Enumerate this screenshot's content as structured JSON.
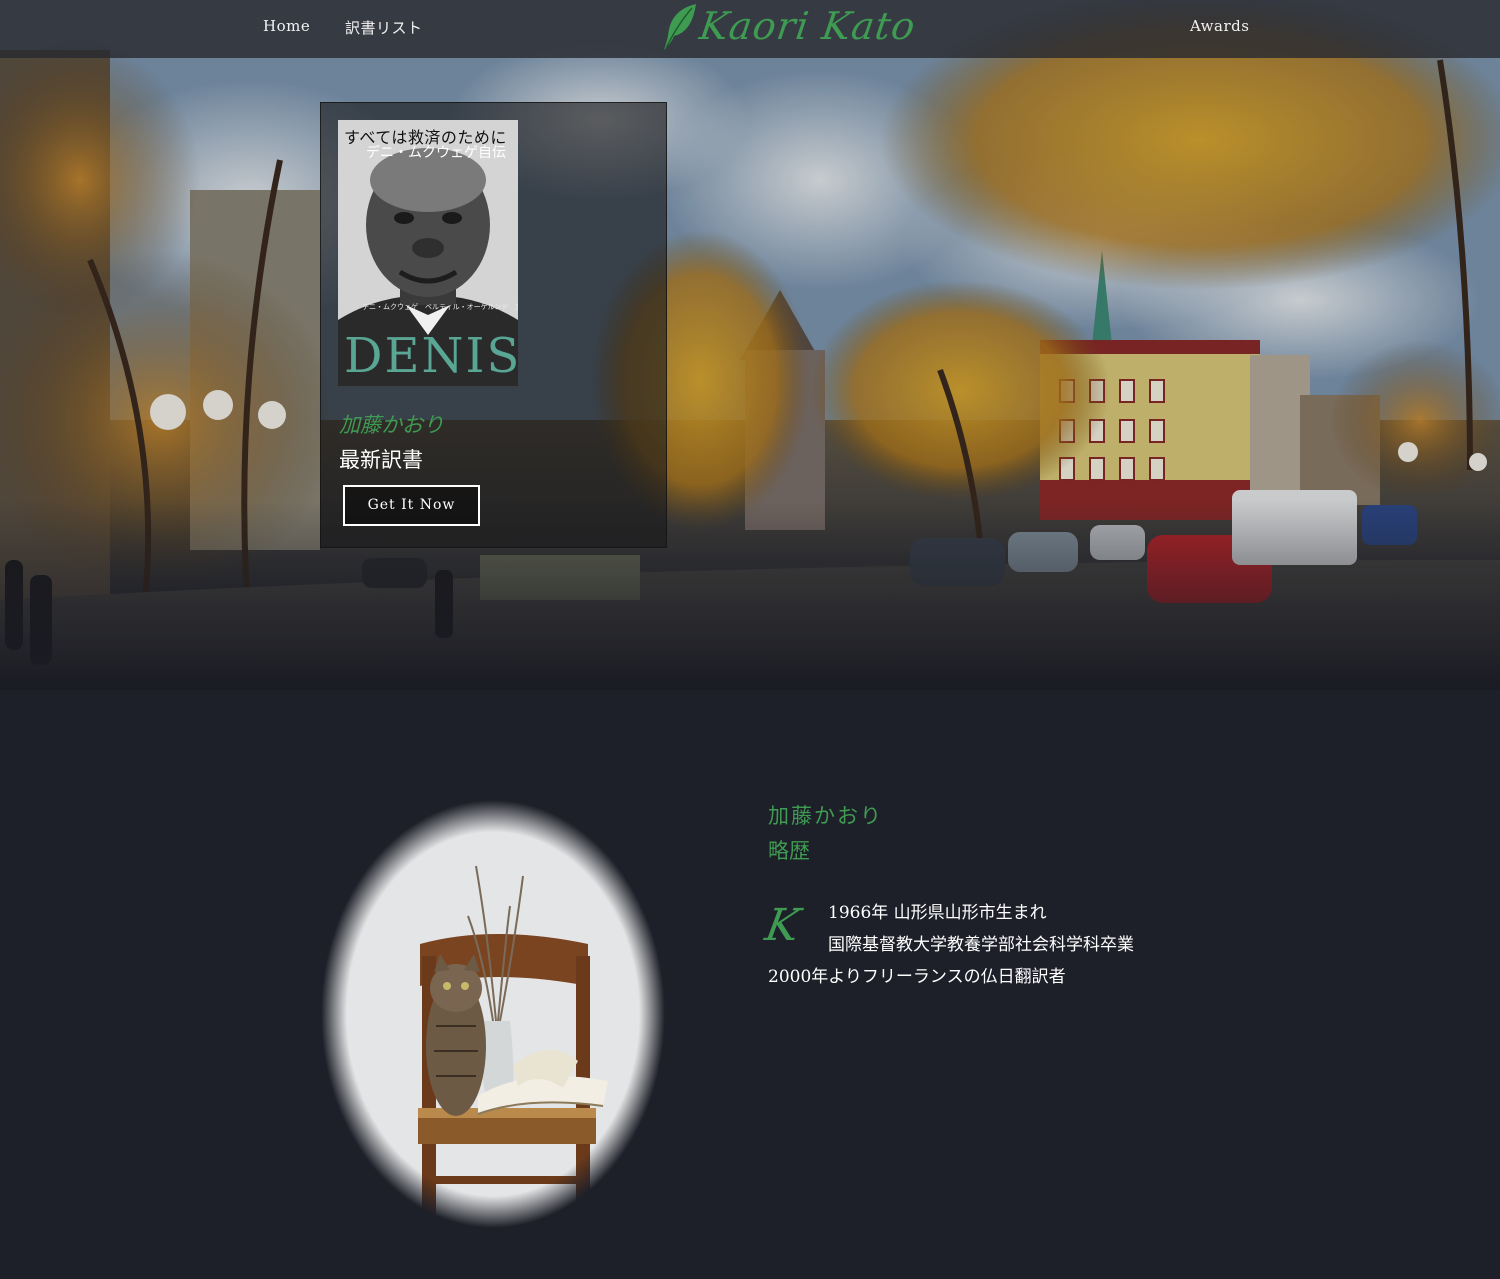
{
  "nav": {
    "home_label": "Home",
    "list_label": "訳書リスト",
    "brand": "Kaori Kato",
    "awards_label": "Awards"
  },
  "hero": {
    "cover": {
      "title": "すべては救済のために",
      "subtitle": "デニ・ムクウェゲ自伝",
      "authors": "デニ・ムクウェゲ　ベルティル・オーケルンド　加藤かおり",
      "big_title": "DENIS"
    },
    "author": "加藤かおり",
    "label": "最新訳書",
    "button_label": "Get It Now"
  },
  "bio": {
    "name": "加藤かおり",
    "heading": "略歴",
    "dropcap": "K",
    "lines": [
      "1966年 山形県山形市生まれ",
      "国際基督教大学教養学部社会科学科卒業",
      "2000年よりフリーランスの仏日翻訳者"
    ]
  },
  "colors": {
    "accent": "#3f9a52",
    "background": "#1e2029",
    "nav_bg": "#2a2c30",
    "text": "#ffffff"
  }
}
